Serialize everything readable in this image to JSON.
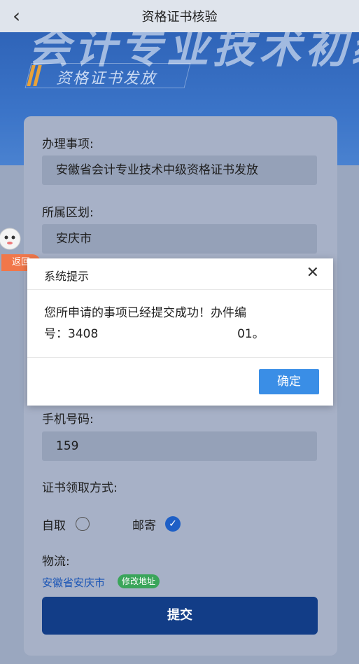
{
  "nav": {
    "back_icon": "chevron-left-icon",
    "back_glyph": "‹",
    "title": "资格证书核验"
  },
  "hero": {
    "headline": "会计专业技术初级",
    "subtitle": "资格证书发放"
  },
  "form": {
    "item_label": "办理事项:",
    "item_value": "安徽省会计专业技术中级资格证书发放",
    "district_label": "所属区划:",
    "district_value": "安庆市",
    "phone_label": "手机号码:",
    "phone_value": "159",
    "pickup_label": "证书领取方式:",
    "pickup_options": [
      {
        "label": "自取",
        "selected": false
      },
      {
        "label": "邮寄",
        "selected": true
      }
    ],
    "logistics_label": "物流:",
    "address": "安徽省安庆市",
    "edit_address": "修改地址",
    "submit": "提交"
  },
  "floating": {
    "return_label": "返回",
    "mascot_icon": "mascot-icon"
  },
  "modal": {
    "title": "系统提示",
    "close_glyph": "✕",
    "message_line1": "您所申请的事项已经提交成功！办件编",
    "message_line2_prefix": "号：3408",
    "message_line2_suffix": "01。",
    "confirm": "确定"
  },
  "colors": {
    "primary": "#123d87",
    "confirm": "#3a8ee6",
    "badge": "#3aa55a",
    "link": "#1c56b6",
    "return_pill": "#f1774a"
  }
}
